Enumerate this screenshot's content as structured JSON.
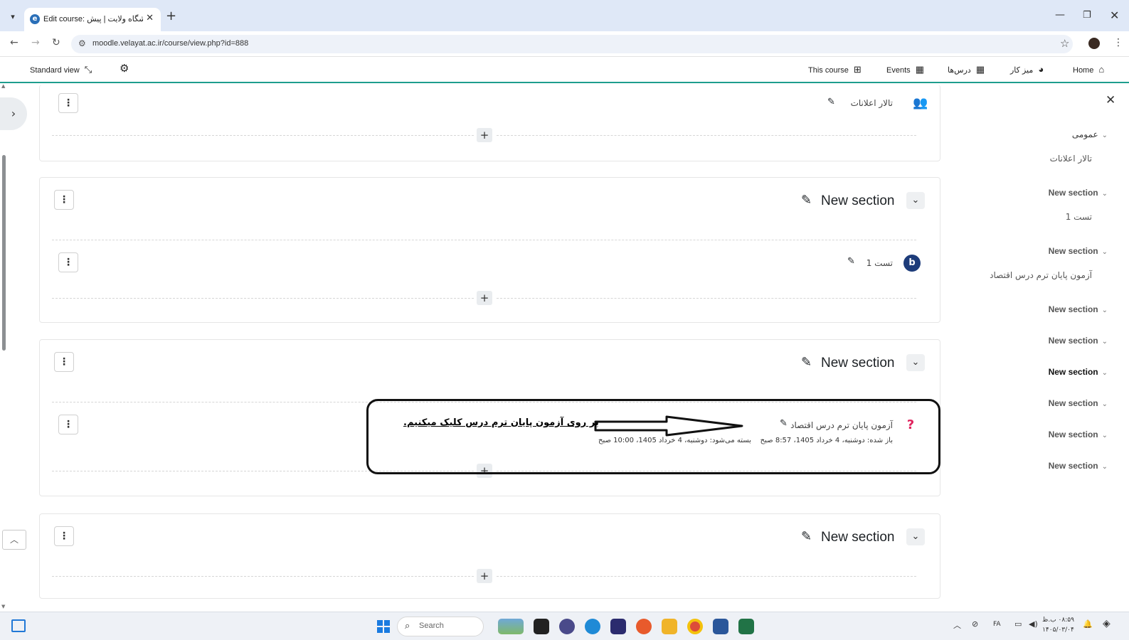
{
  "browser": {
    "tab_title": "Edit course: دانشگاه ولایت | پیش",
    "url": "moodle.velayat.ac.ir/course/view.php?id=888"
  },
  "navbar": {
    "home": "Home",
    "dashboard": "میز کار",
    "my_courses": "درس‌ها",
    "events": "Events",
    "this_course": "This course",
    "standard_view": "Standard view"
  },
  "sections": [
    {
      "title": "",
      "activities": [
        {
          "name": "تالار اعلانات",
          "icon": "forum-icon",
          "color": "#8a2be2"
        }
      ]
    },
    {
      "title": "New section",
      "activities": [
        {
          "name": "تست 1",
          "icon": "h5p-icon",
          "color": "#1d3c7a"
        }
      ]
    },
    {
      "title": "New section",
      "activities": [
        {
          "name": "آزمون پایان ترم درس اقتصاد",
          "icon": "quiz-icon",
          "color": "#e0245e",
          "opened": "باز شده: دوشنبه، 4 خرداد 1405، 8:57 صبح",
          "closes": "بسته می‌شود: دوشنبه، 4 خرداد 1405، 10:00 صبح"
        }
      ]
    },
    {
      "title": "New section",
      "activities": []
    }
  ],
  "annotation": {
    "text": "بر روی آزمون پایان ترم درس کلیک میکنیم."
  },
  "drawer": {
    "general": "عمومی",
    "general_item": "تالار اعلانات",
    "section_label": "New section",
    "items": [
      {
        "label": "New section",
        "sub": "تست 1"
      },
      {
        "label": "New section",
        "sub": "آزمون پایان ترم درس اقتصاد"
      },
      {
        "label": "New section"
      },
      {
        "label": "New section"
      },
      {
        "label": "New section",
        "active": true
      },
      {
        "label": "New section"
      },
      {
        "label": "New section"
      },
      {
        "label": "New section"
      }
    ]
  },
  "taskbar": {
    "search": "Search",
    "clock_time": "۰۸:۵۹ ب.ظ",
    "clock_date": "۱۴۰۵/۰۳/۰۴",
    "lang": "FA"
  }
}
